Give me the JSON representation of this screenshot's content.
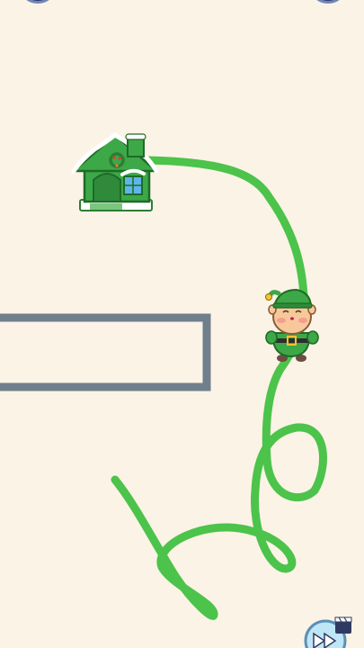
{
  "level": {
    "goal": "house",
    "character": "elf",
    "drawn_line_color": "#4CC34A",
    "wall_color": "#6F7F8C",
    "background_color": "#FBF3E6"
  },
  "icons": {
    "top_left": "menu-button",
    "top_right": "settings-button",
    "skip": "fast-forward-video-icon"
  }
}
